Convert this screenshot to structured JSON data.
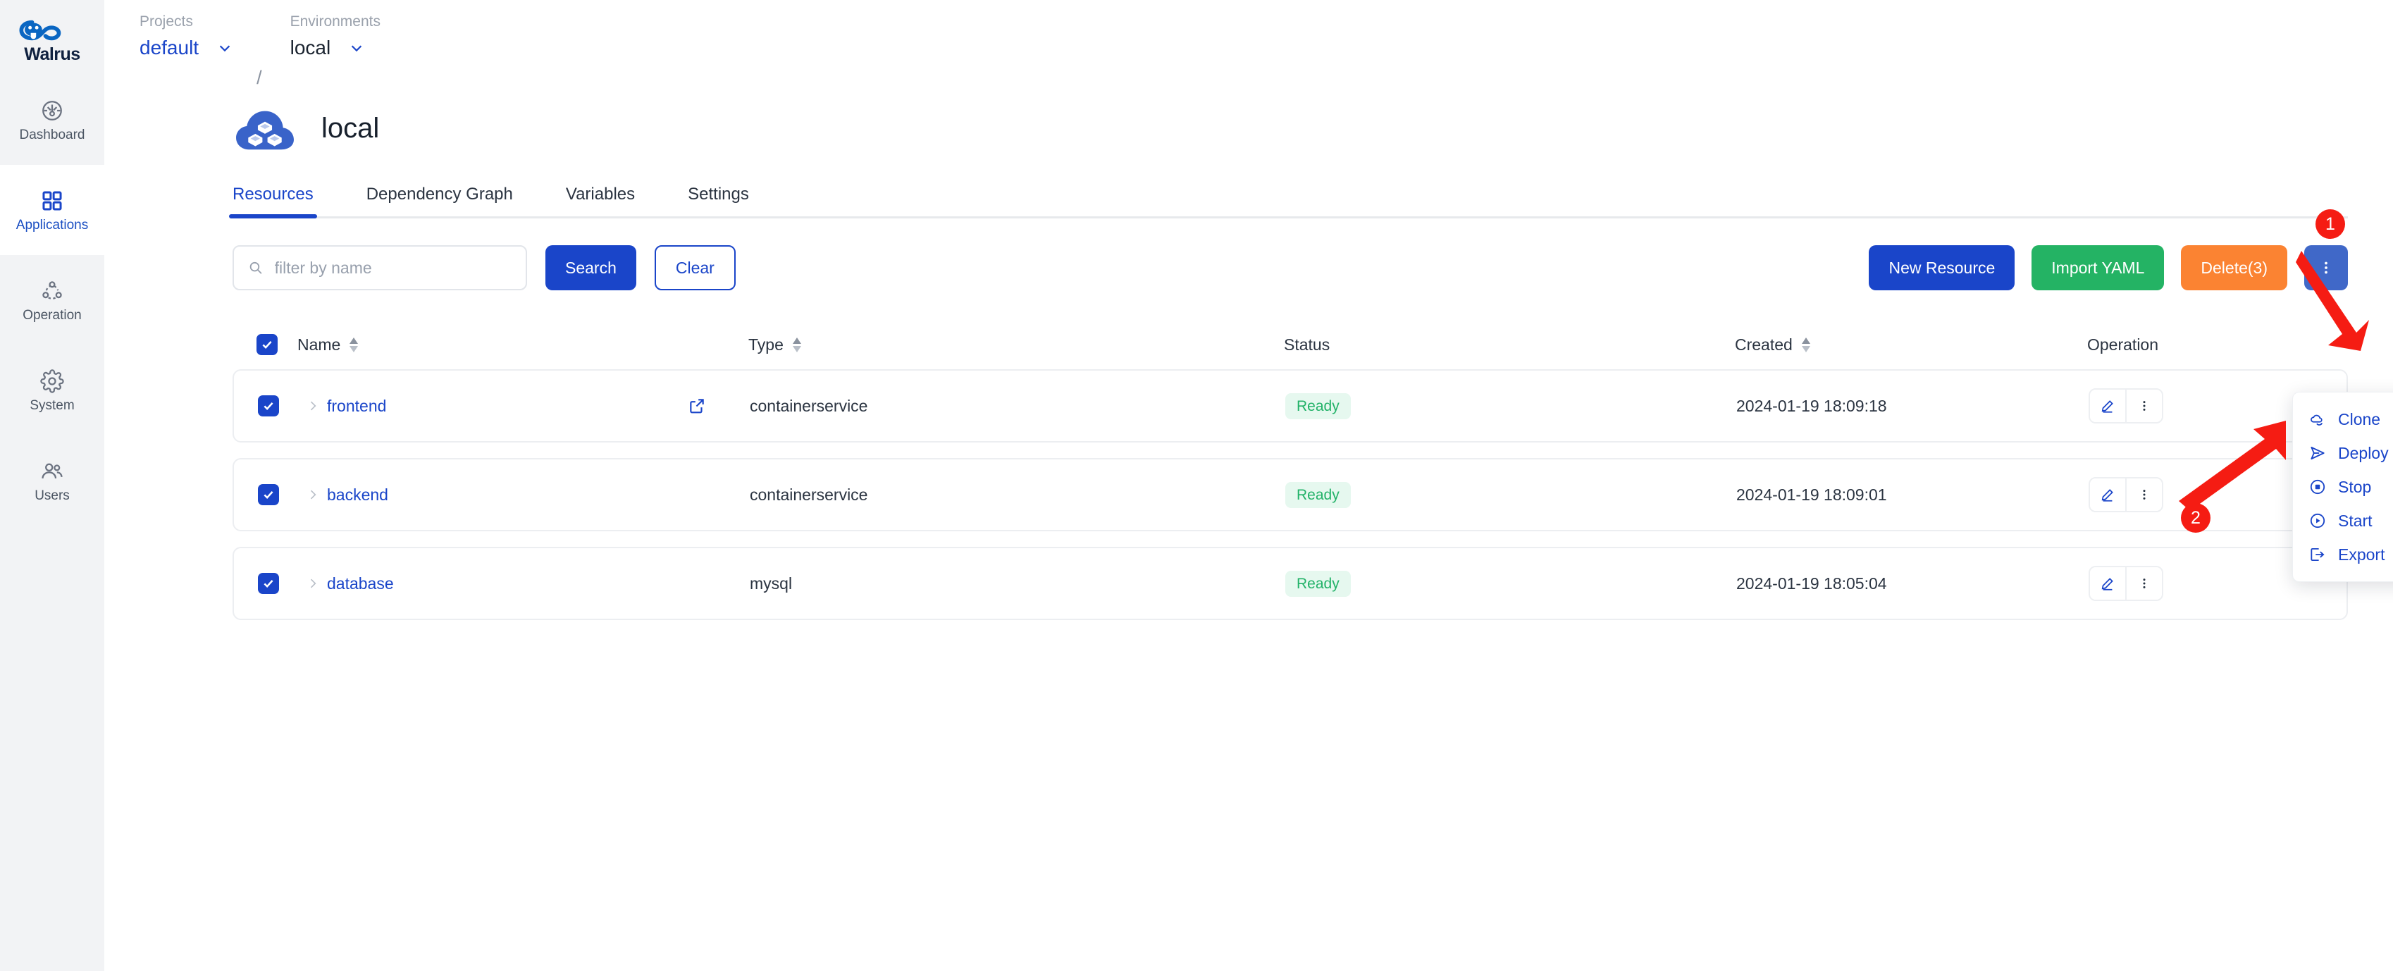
{
  "sidebar": {
    "brand": "Walrus",
    "items": [
      {
        "label": "Dashboard",
        "icon": "dashboard-icon",
        "active": false
      },
      {
        "label": "Applications",
        "icon": "applications-icon",
        "active": true
      },
      {
        "label": "Operation",
        "icon": "operation-icon",
        "active": false
      },
      {
        "label": "System",
        "icon": "system-gear-icon",
        "active": false
      },
      {
        "label": "Users",
        "icon": "users-icon",
        "active": false
      }
    ]
  },
  "breadcrumb": {
    "project": {
      "label": "Projects",
      "value": "default"
    },
    "separator": "/",
    "environment": {
      "label": "Environments",
      "value": "local"
    }
  },
  "page": {
    "title": "local",
    "icon": "cloud-cubes-icon"
  },
  "tabs": [
    {
      "label": "Resources",
      "active": true
    },
    {
      "label": "Dependency Graph",
      "active": false
    },
    {
      "label": "Variables",
      "active": false
    },
    {
      "label": "Settings",
      "active": false
    }
  ],
  "toolbar": {
    "search_placeholder": "filter by name",
    "search_value": "",
    "search_button": "Search",
    "clear_button": "Clear",
    "new_resource_button": "New Resource",
    "import_yaml_button": "Import YAML",
    "delete_button": "Delete(3)",
    "more_button_icon": "kebab-vertical-icon"
  },
  "dropdown_menu": {
    "items": [
      {
        "label": "Clone",
        "icon": "clone-clouds-icon"
      },
      {
        "label": "Deploy",
        "icon": "deploy-send-icon"
      },
      {
        "label": "Stop",
        "icon": "stop-circle-icon"
      },
      {
        "label": "Start",
        "icon": "play-circle-icon"
      },
      {
        "label": "Export",
        "icon": "export-arrow-icon"
      }
    ]
  },
  "table": {
    "header_checkbox_checked": true,
    "columns": [
      {
        "key": "name",
        "label": "Name",
        "sortable": true
      },
      {
        "key": "type",
        "label": "Type",
        "sortable": true
      },
      {
        "key": "status",
        "label": "Status",
        "sortable": false
      },
      {
        "key": "created",
        "label": "Created",
        "sortable": true
      },
      {
        "key": "op",
        "label": "Operation",
        "sortable": false
      }
    ],
    "rows": [
      {
        "checked": true,
        "name": "frontend",
        "external_link": true,
        "type": "containerservice",
        "status": "Ready",
        "created": "2024-01-19 18:09:18"
      },
      {
        "checked": true,
        "name": "backend",
        "external_link": false,
        "type": "containerservice",
        "status": "Ready",
        "created": "2024-01-19 18:09:01"
      },
      {
        "checked": true,
        "name": "database",
        "external_link": false,
        "type": "mysql",
        "status": "Ready",
        "created": "2024-01-19 18:05:04"
      }
    ]
  },
  "annotations": [
    {
      "number": "1"
    },
    {
      "number": "2"
    }
  ],
  "colors": {
    "accent_blue": "#1a45c9",
    "green": "#24b364",
    "orange": "#fb8332",
    "status_green_text": "#22b268",
    "status_green_bg": "#e6f8ef",
    "annotation_red": "#f51c13",
    "sidebar_bg": "#f2f3f5"
  }
}
